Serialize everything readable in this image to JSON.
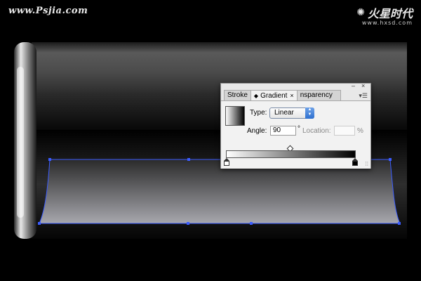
{
  "watermark": {
    "left_text": "www.Psjia.com",
    "right_logo_text": "火星时代",
    "right_logo_sub": "www.hxsd.com"
  },
  "panel": {
    "tabs": [
      {
        "label": "Stroke"
      },
      {
        "label": "Gradient"
      },
      {
        "label": "nsparency"
      }
    ],
    "type_label": "Type:",
    "type_value": "Linear",
    "angle_label": "Angle:",
    "angle_value": "90",
    "angle_unit": "°",
    "location_label": "Location:",
    "location_value": "",
    "location_unit": "%",
    "close_glyph": "×",
    "minimize_glyph": "–",
    "menu_glyph": "▾☰",
    "resize_glyph": "⁞⁞"
  },
  "gradient_ramp": {
    "start_color": "#ffffff",
    "end_color": "#000000",
    "midpoint_percent": 50
  },
  "colors": {
    "background": "#000000",
    "selection_outline": "#3b5cff"
  }
}
